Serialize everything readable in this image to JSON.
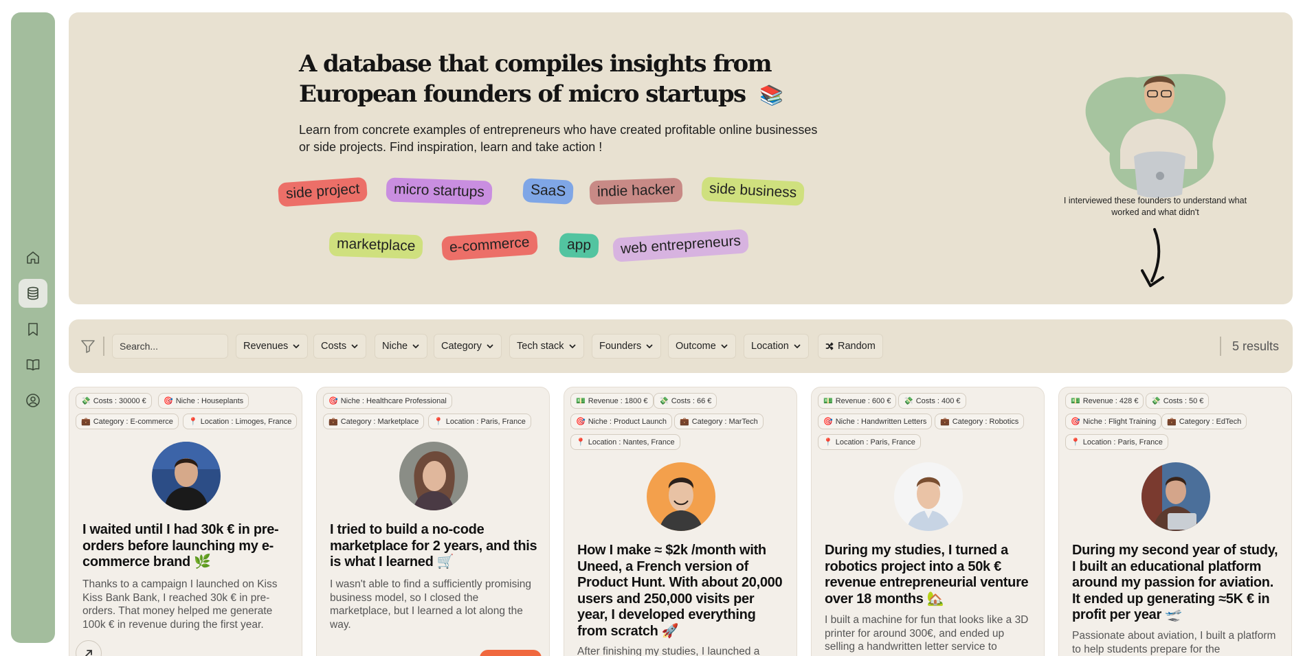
{
  "hero": {
    "title": "A database that compiles insights from European founders of micro startups",
    "title_emoji": "📚",
    "description": "Learn from concrete examples of entrepreneurs who have created profitable online businesses or side projects. Find inspiration, learn and take action !",
    "tags": [
      "side project",
      "micro startups",
      "SaaS",
      "indie hacker",
      "side business",
      "marketplace",
      "e-commerce",
      "app",
      "web entrepreneurs"
    ],
    "interview_note": "I interviewed these founders to understand what worked and what didn't"
  },
  "filters": {
    "search_placeholder": "Search...",
    "buttons": [
      "Revenues",
      "Costs",
      "Niche",
      "Category",
      "Tech stack",
      "Founders",
      "Outcome",
      "Location"
    ],
    "random_label": "Random",
    "results": "5 results"
  },
  "cards": [
    {
      "chips": [
        {
          "icon": "💸",
          "text": "Costs : 30000 €"
        },
        {
          "icon": "🎯",
          "text": "Niche : Houseplants"
        },
        {
          "icon": "💼",
          "text": "Category : E-commerce"
        },
        {
          "icon": "📍",
          "text": "Location : Limoges, France"
        }
      ],
      "title": "I waited until I had 30k € in pre-orders before launching my e-commerce brand 🌿",
      "text": "Thanks to a campaign I launched on Kiss Kiss Bank Bank, I reached 30k € in pre-orders. That money helped me generate 100k € in revenue during the first year."
    },
    {
      "chips": [
        {
          "icon": "🎯",
          "text": "Niche : Healthcare Professional"
        },
        {
          "icon": "💼",
          "text": "Category : Marketplace"
        },
        {
          "icon": "📍",
          "text": "Location : Paris, France"
        }
      ],
      "title": "I tried to build a no-code marketplace for 2 years, and this is what I learned 🛒",
      "text": "I wasn't able to find a sufficiently promising business model, so I closed the marketplace, but I learned a lot along the way."
    },
    {
      "chips": [
        {
          "icon": "💵",
          "text": "Revenue : 1800 €"
        },
        {
          "icon": "💸",
          "text": "Costs : 66 €"
        },
        {
          "icon": "🎯",
          "text": "Niche : Product Launch"
        },
        {
          "icon": "💼",
          "text": "Category : MarTech"
        },
        {
          "icon": "📍",
          "text": "Location : Nantes, France"
        }
      ],
      "title": "How I make ≈ $2k /month with Uneed, a French version of Product Hunt. With about 20,000 users and 250,000 visits per year, I developed everything from scratch 🚀",
      "text": "After finishing my studies, I launched a"
    },
    {
      "chips": [
        {
          "icon": "💵",
          "text": "Revenue : 600 €"
        },
        {
          "icon": "💸",
          "text": "Costs : 400 €"
        },
        {
          "icon": "🎯",
          "text": "Niche : Handwritten Letters"
        },
        {
          "icon": "💼",
          "text": "Category : Robotics"
        },
        {
          "icon": "📍",
          "text": "Location : Paris, France"
        }
      ],
      "title": "During my studies, I turned a robotics project into a 50k € revenue entrepreneurial venture over 18 months 🏡",
      "text": "I built a machine for fun that looks like a 3D printer for around 300€, and ended up selling a handwritten letter service to"
    },
    {
      "chips": [
        {
          "icon": "💵",
          "text": "Revenue : 428 €"
        },
        {
          "icon": "💸",
          "text": "Costs : 50 €"
        },
        {
          "icon": "🎯",
          "text": "Niche : Flight Training"
        },
        {
          "icon": "💼",
          "text": "Category : EdTech"
        },
        {
          "icon": "📍",
          "text": "Location : Paris, France"
        }
      ],
      "title": "During my second year of study, I built an educational platform around my passion for aviation. It ended up generating ≈5K € in profit per year 🛫",
      "text": "Passionate about aviation, I built a platform to help students prepare for the"
    }
  ],
  "icons": {
    "sidebar": [
      "home-icon",
      "database-icon",
      "bookmark-icon",
      "book-icon",
      "user-circle-icon"
    ],
    "filter": "funnel-icon",
    "random": "shuffle-icon",
    "open": "arrow-up-right-icon"
  },
  "colors": {
    "sidebar": "#a3bd9d",
    "hero_bg": "#e8e1d1",
    "card_bg": "#f3efe9",
    "tags": [
      "#ec6f68",
      "#c98ee0",
      "#7fa6e6",
      "#c88a86",
      "#cfe07e",
      "#cfe07e",
      "#ec6f68",
      "#52c4a0",
      "#d7b3e0"
    ]
  }
}
